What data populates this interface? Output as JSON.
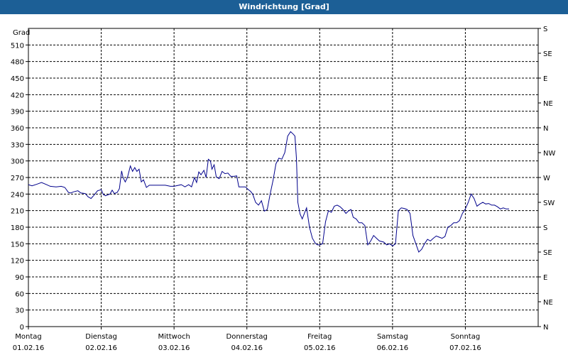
{
  "window": {
    "title": "Windrichtung [Grad]"
  },
  "colors": {
    "titlebar": "#1c5f96",
    "line": "#00008b",
    "grid": "#000000"
  },
  "chart_data": {
    "type": "line",
    "title": "Windrichtung [Grad]",
    "ylabel": "Grad",
    "ylim": [
      0,
      540
    ],
    "y_ticks": [
      0,
      30,
      60,
      90,
      120,
      150,
      180,
      210,
      240,
      270,
      300,
      330,
      360,
      390,
      420,
      450,
      480,
      510
    ],
    "right_axis_labels": [
      "N",
      "NE",
      "E",
      "SE",
      "S",
      "SW",
      "W",
      "NW",
      "N",
      "NE",
      "E",
      "SE",
      "S"
    ],
    "x_categories": [
      {
        "day": "Montag",
        "date": "01.02.16"
      },
      {
        "day": "Dienstag",
        "date": "02.02.16"
      },
      {
        "day": "Mittwoch",
        "date": "03.02.16"
      },
      {
        "day": "Donnerstag",
        "date": "04.02.16"
      },
      {
        "day": "Freitag",
        "date": "05.02.16"
      },
      {
        "day": "Samstag",
        "date": "06.02.16"
      },
      {
        "day": "Sonntag",
        "date": "07.02.16"
      }
    ],
    "grid": true,
    "series": [
      {
        "x_unit": "days since 01.02.16 00:00",
        "points": [
          [
            0.0,
            257
          ],
          [
            0.05,
            255
          ],
          [
            0.12,
            258
          ],
          [
            0.18,
            261
          ],
          [
            0.25,
            257
          ],
          [
            0.3,
            254
          ],
          [
            0.38,
            253
          ],
          [
            0.45,
            254
          ],
          [
            0.5,
            252
          ],
          [
            0.55,
            243
          ],
          [
            0.58,
            242
          ],
          [
            0.62,
            244
          ],
          [
            0.68,
            246
          ],
          [
            0.72,
            242
          ],
          [
            0.78,
            241
          ],
          [
            0.82,
            235
          ],
          [
            0.86,
            232
          ],
          [
            0.9,
            238
          ],
          [
            0.95,
            246
          ],
          [
            1.0,
            248
          ],
          [
            1.03,
            239
          ],
          [
            1.06,
            237
          ],
          [
            1.12,
            240
          ],
          [
            1.15,
            247
          ],
          [
            1.18,
            241
          ],
          [
            1.22,
            243
          ],
          [
            1.25,
            250
          ],
          [
            1.28,
            282
          ],
          [
            1.3,
            270
          ],
          [
            1.33,
            262
          ],
          [
            1.36,
            270
          ],
          [
            1.4,
            291
          ],
          [
            1.43,
            281
          ],
          [
            1.46,
            288
          ],
          [
            1.49,
            281
          ],
          [
            1.52,
            285
          ],
          [
            1.55,
            262
          ],
          [
            1.58,
            266
          ],
          [
            1.62,
            252
          ],
          [
            1.66,
            256
          ],
          [
            1.72,
            256
          ],
          [
            1.8,
            256
          ],
          [
            1.88,
            256
          ],
          [
            1.95,
            254
          ],
          [
            2.0,
            254
          ],
          [
            2.1,
            257
          ],
          [
            2.15,
            253
          ],
          [
            2.2,
            257
          ],
          [
            2.24,
            253
          ],
          [
            2.28,
            270
          ],
          [
            2.31,
            261
          ],
          [
            2.34,
            280
          ],
          [
            2.37,
            275
          ],
          [
            2.41,
            283
          ],
          [
            2.44,
            270
          ],
          [
            2.47,
            303
          ],
          [
            2.5,
            300
          ],
          [
            2.52,
            285
          ],
          [
            2.55,
            293
          ],
          [
            2.58,
            271
          ],
          [
            2.62,
            268
          ],
          [
            2.66,
            281
          ],
          [
            2.7,
            277
          ],
          [
            2.74,
            278
          ],
          [
            2.78,
            272
          ],
          [
            2.82,
            272
          ],
          [
            2.86,
            273
          ],
          [
            2.89,
            253
          ],
          [
            2.93,
            253
          ],
          [
            2.98,
            253
          ],
          [
            3.02,
            248
          ],
          [
            3.05,
            245
          ],
          [
            3.08,
            240
          ],
          [
            3.12,
            225
          ],
          [
            3.16,
            220
          ],
          [
            3.2,
            228
          ],
          [
            3.24,
            209
          ],
          [
            3.28,
            212
          ],
          [
            3.32,
            240
          ],
          [
            3.36,
            265
          ],
          [
            3.4,
            295
          ],
          [
            3.44,
            305
          ],
          [
            3.48,
            303
          ],
          [
            3.52,
            315
          ],
          [
            3.56,
            345
          ],
          [
            3.6,
            353
          ],
          [
            3.64,
            348
          ],
          [
            3.66,
            345
          ],
          [
            3.68,
            305
          ],
          [
            3.7,
            225
          ],
          [
            3.73,
            204
          ],
          [
            3.76,
            195
          ],
          [
            3.79,
            205
          ],
          [
            3.82,
            215
          ],
          [
            3.86,
            180
          ],
          [
            3.9,
            160
          ],
          [
            3.94,
            151
          ],
          [
            3.97,
            148
          ],
          [
            4.0,
            148
          ],
          [
            4.04,
            150
          ],
          [
            4.08,
            190
          ],
          [
            4.12,
            210
          ],
          [
            4.16,
            207
          ],
          [
            4.2,
            218
          ],
          [
            4.24,
            220
          ],
          [
            4.28,
            217
          ],
          [
            4.32,
            212
          ],
          [
            4.36,
            205
          ],
          [
            4.4,
            210
          ],
          [
            4.43,
            212
          ],
          [
            4.46,
            198
          ],
          [
            4.5,
            195
          ],
          [
            4.54,
            188
          ],
          [
            4.58,
            188
          ],
          [
            4.62,
            183
          ],
          [
            4.66,
            148
          ],
          [
            4.7,
            155
          ],
          [
            4.74,
            165
          ],
          [
            4.78,
            160
          ],
          [
            4.82,
            155
          ],
          [
            4.88,
            153
          ],
          [
            4.92,
            148
          ],
          [
            4.96,
            150
          ],
          [
            5.0,
            146
          ],
          [
            5.04,
            150
          ],
          [
            5.08,
            210
          ],
          [
            5.12,
            215
          ],
          [
            5.16,
            214
          ],
          [
            5.2,
            212
          ],
          [
            5.24,
            205
          ],
          [
            5.28,
            165
          ],
          [
            5.32,
            150
          ],
          [
            5.36,
            135
          ],
          [
            5.4,
            140
          ],
          [
            5.44,
            150
          ],
          [
            5.48,
            158
          ],
          [
            5.52,
            155
          ],
          [
            5.56,
            160
          ],
          [
            5.6,
            164
          ],
          [
            5.64,
            162
          ],
          [
            5.68,
            160
          ],
          [
            5.72,
            163
          ],
          [
            5.76,
            180
          ],
          [
            5.8,
            183
          ],
          [
            5.84,
            188
          ],
          [
            5.88,
            188
          ],
          [
            5.92,
            192
          ],
          [
            5.96,
            205
          ],
          [
            6.0,
            213
          ],
          [
            6.04,
            225
          ],
          [
            6.08,
            240
          ],
          [
            6.12,
            232
          ],
          [
            6.16,
            218
          ],
          [
            6.2,
            222
          ],
          [
            6.24,
            225
          ],
          [
            6.28,
            222
          ],
          [
            6.32,
            223
          ],
          [
            6.36,
            220
          ],
          [
            6.4,
            220
          ],
          [
            6.44,
            217
          ],
          [
            6.48,
            213
          ],
          [
            6.52,
            215
          ],
          [
            6.56,
            213
          ],
          [
            6.6,
            213
          ]
        ]
      }
    ]
  }
}
